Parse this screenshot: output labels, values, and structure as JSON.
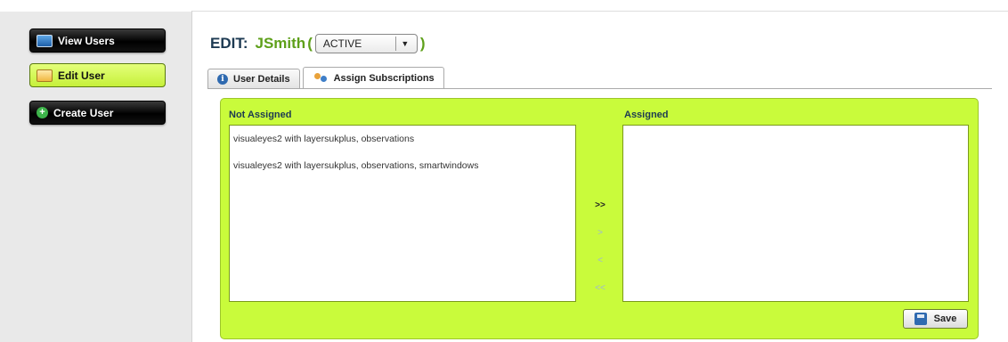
{
  "sidebar": {
    "items": [
      {
        "label": "View Users",
        "icon": "users-icon"
      },
      {
        "label": "Edit User",
        "icon": "edit-icon"
      },
      {
        "label": "Create User",
        "icon": "plus-circle-icon"
      }
    ]
  },
  "header": {
    "edit_label": "EDIT:",
    "username": "JSmith",
    "open_paren": "(",
    "close_paren": ")",
    "status_value": "ACTIVE"
  },
  "tabs": [
    {
      "label": "User Details",
      "icon": "info-icon"
    },
    {
      "label": "Assign Subscriptions",
      "icon": "people-icon"
    }
  ],
  "assign": {
    "not_assigned_label": "Not Assigned",
    "assigned_label": "Assigned",
    "not_assigned_items": [
      "visualeyes2 with layersukplus, observations",
      "visualeyes2 with layersukplus, observations, smartwindows"
    ],
    "assigned_items": [],
    "move_all_right": ">>",
    "move_right": ">",
    "move_left": "<",
    "move_all_left": "<<",
    "save_label": "Save"
  },
  "colors": {
    "accent_green": "#c9fb3b",
    "username_green": "#5ea01a",
    "title_navy": "#1d3a52"
  }
}
